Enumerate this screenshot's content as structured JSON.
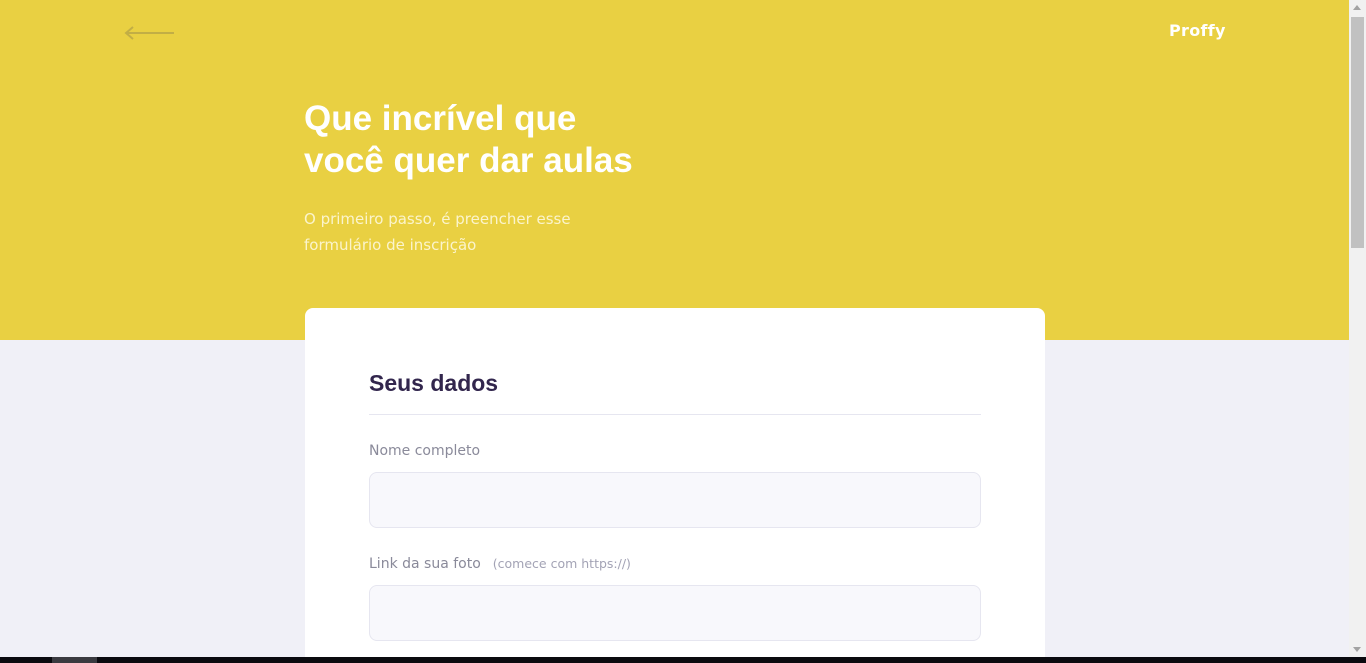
{
  "header": {
    "back_icon": "arrow-left-icon",
    "logo_text": "Proffy"
  },
  "hero": {
    "title_line1": "Que incrível que",
    "title_line2": "você quer dar aulas",
    "subtitle_line1": "O primeiro passo, é preencher esse",
    "subtitle_line2": "formulário de inscrição"
  },
  "form": {
    "section_title": "Seus dados",
    "fields": [
      {
        "label": "Nome completo",
        "hint": "",
        "value": ""
      },
      {
        "label": "Link da sua foto",
        "hint": "(comece com https://)",
        "value": ""
      }
    ]
  },
  "colors": {
    "primary": "#e9d042",
    "background": "#f0f0f7",
    "title": "#32264d"
  }
}
